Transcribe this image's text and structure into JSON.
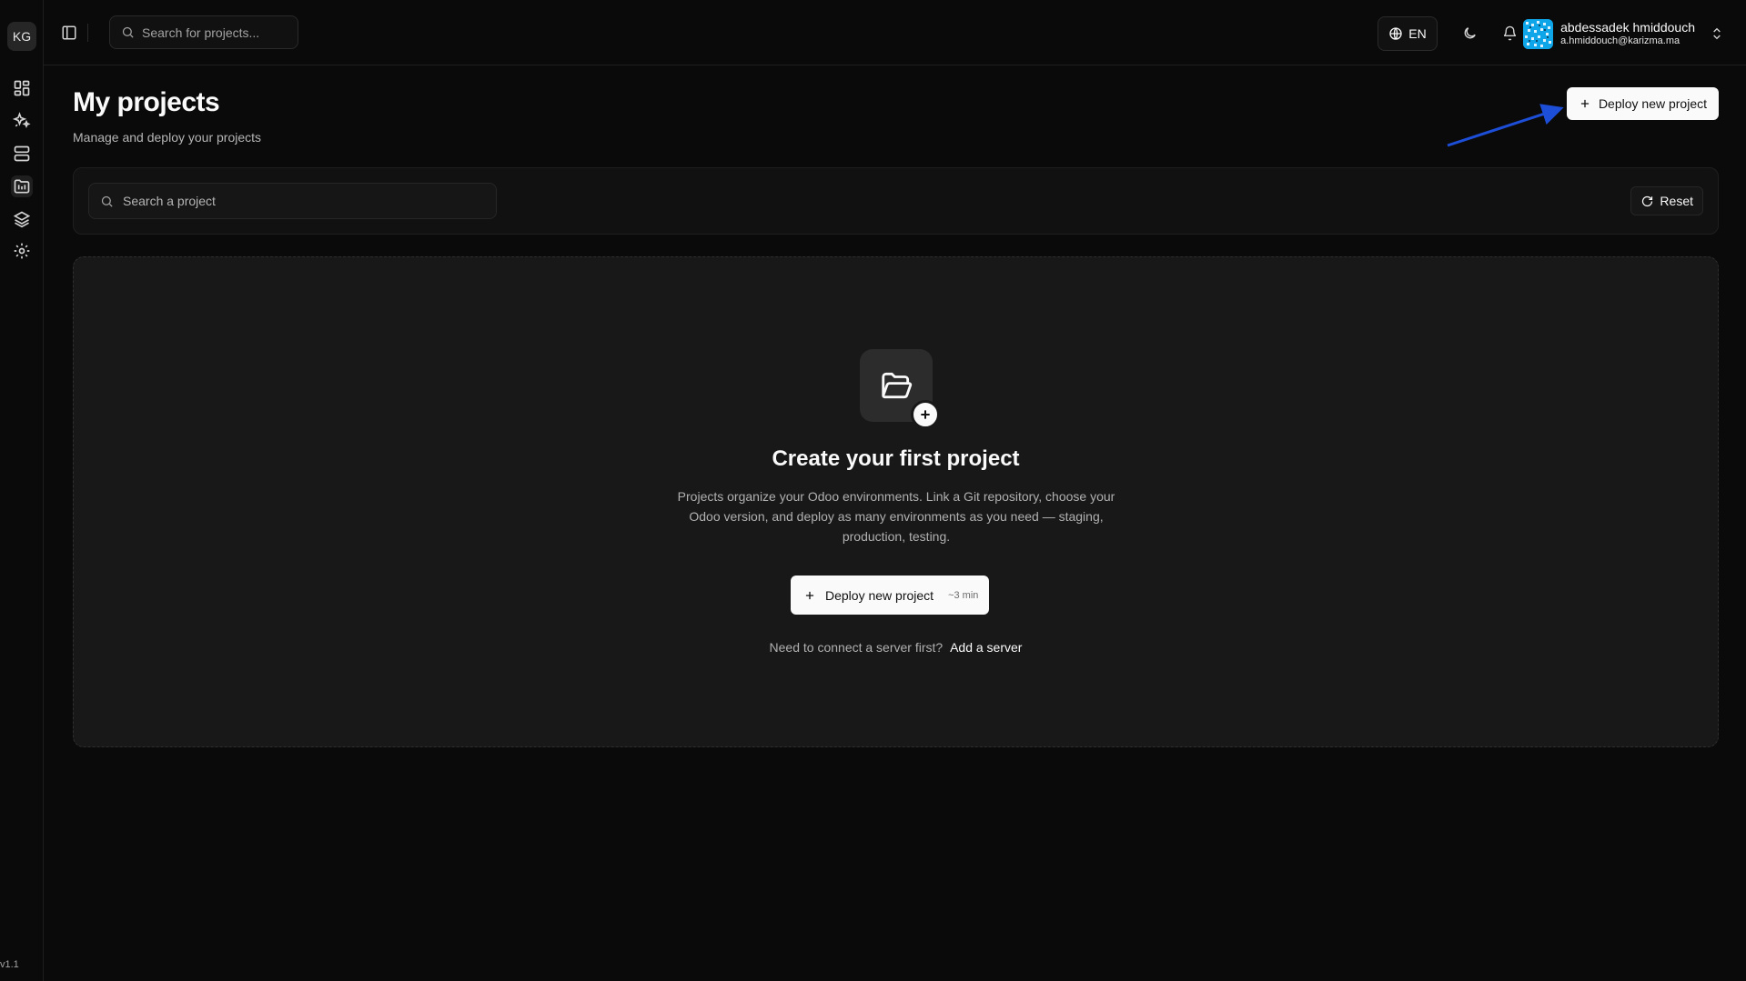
{
  "sidebar": {
    "brand": "KG",
    "items": [
      {
        "name": "dashboard-icon"
      },
      {
        "name": "sparkles-icon"
      },
      {
        "name": "server-icon"
      },
      {
        "name": "projects-icon"
      },
      {
        "name": "layers-icon"
      },
      {
        "name": "settings-icon"
      }
    ],
    "version": "v1.1"
  },
  "topbar": {
    "search_placeholder": "Search for projects...",
    "language": "EN",
    "user": {
      "name": "abdessadek hmiddouch",
      "email": "a.hmiddouch@karizma.ma"
    }
  },
  "page": {
    "title": "My projects",
    "subtitle": "Manage and deploy your projects",
    "deploy_button": "Deploy new project"
  },
  "filters": {
    "search_placeholder": "Search a project",
    "reset_label": "Reset"
  },
  "empty_state": {
    "title": "Create your first project",
    "description": "Projects organize your Odoo environments. Link a Git repository, choose your Odoo version, and deploy as many environments as you need — staging, production, testing.",
    "deploy_label": "Deploy new project",
    "deploy_eta": "~3 min",
    "server_prompt": "Need to connect a server first?",
    "server_link": "Add a server"
  },
  "colors": {
    "background": "#0a0a0a",
    "card": "#181818",
    "primary_button": "#fafafa",
    "annotation_arrow": "#1d4ed8"
  }
}
